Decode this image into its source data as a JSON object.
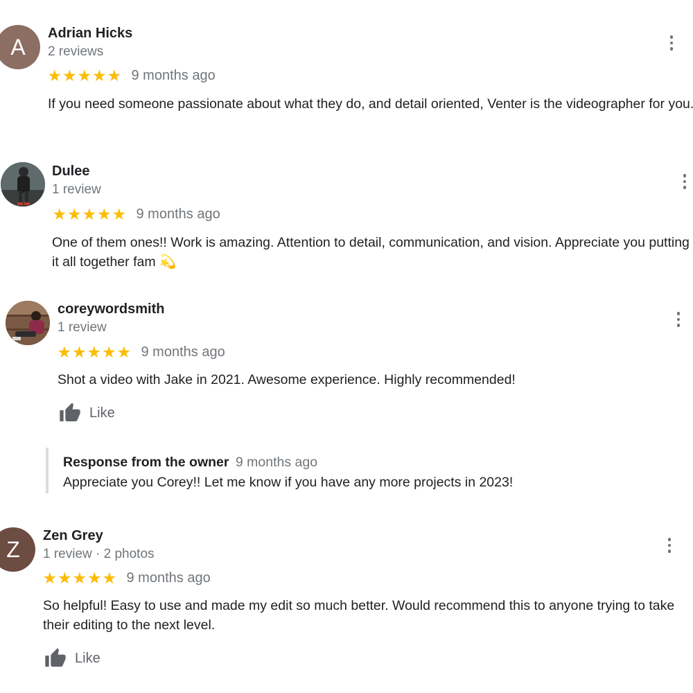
{
  "reviews": [
    {
      "initial": "A",
      "avatar_color": "#8d6e63",
      "name": "Adrian Hicks",
      "meta": "2 reviews",
      "rating": 5,
      "ago": "9 months ago",
      "text": "If you need someone passionate about what they do, and detail oriented, Venter is the videographer for you."
    },
    {
      "name": "Dulee",
      "meta": "1 review",
      "rating": 5,
      "ago": "9 months ago",
      "text": "One of them ones!! Work is amazing. Attention to detail, communication, and vision. Appreciate you putting it all together fam",
      "emoji": "💫"
    },
    {
      "name": "coreywordsmith",
      "meta": "1 review",
      "rating": 5,
      "ago": "9 months ago",
      "text": "Shot a video with Jake in 2021. Awesome experience. Highly recommended!",
      "like_label": "Like",
      "response": {
        "label": "Response from the owner",
        "ago": "9 months ago",
        "text": "Appreciate you Corey!! Let me know if you have any more projects in 2023!"
      }
    },
    {
      "initial": "Z",
      "avatar_color": "#6d4c41",
      "name": "Zen Grey",
      "meta": "1 review · 2 photos",
      "rating": 5,
      "ago": "9 months ago",
      "text": "So helpful! Easy to use and made my edit so much better. Would recommend this to anyone trying to take their editing to the next level.",
      "like_label": "Like"
    }
  ],
  "colors": {
    "star": "#fbbc04",
    "secondary_text": "#70757a",
    "primary_text": "#202124"
  },
  "icons": {
    "star": "star-icon",
    "more": "more-vert-icon",
    "like": "thumb-up-icon"
  }
}
